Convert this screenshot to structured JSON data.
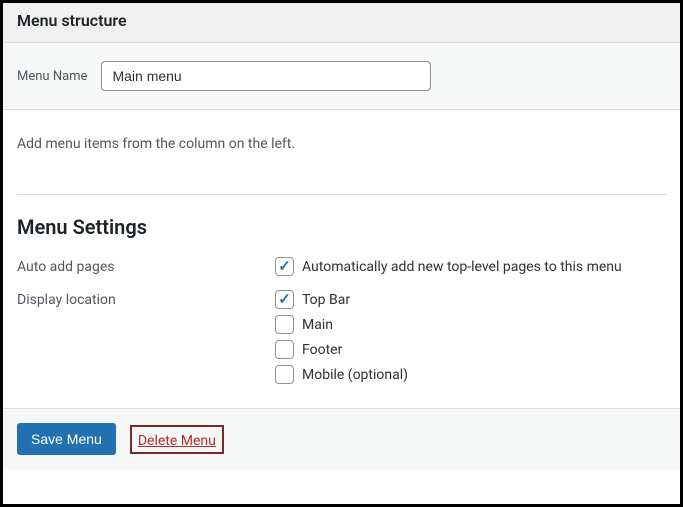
{
  "header": {
    "title": "Menu structure"
  },
  "name_section": {
    "label": "Menu Name",
    "value": "Main menu"
  },
  "body": {
    "help_text": "Add menu items from the column on the left.",
    "settings_heading": "Menu Settings",
    "auto_add": {
      "label": "Auto add pages",
      "option_label": "Automatically add new top-level pages to this menu",
      "checked": true
    },
    "display_location": {
      "label": "Display location",
      "options": [
        {
          "label": "Top Bar",
          "checked": true
        },
        {
          "label": "Main",
          "checked": false
        },
        {
          "label": "Footer",
          "checked": false
        },
        {
          "label": "Mobile (optional)",
          "checked": false
        }
      ]
    }
  },
  "footer": {
    "save_label": "Save Menu",
    "delete_label": "Delete Menu"
  }
}
